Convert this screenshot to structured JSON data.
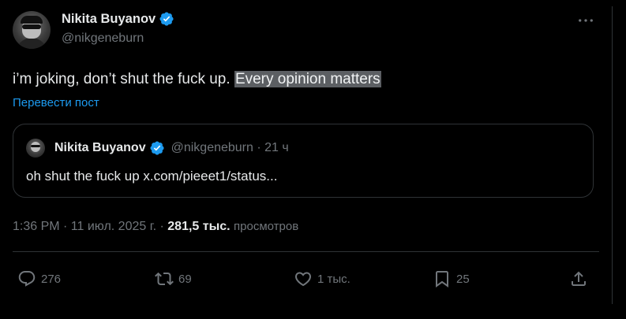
{
  "author": {
    "display_name": "Nikita Buyanov",
    "handle": "@nikgeneburn"
  },
  "tweet": {
    "text_plain": "i’m joking, don’t shut the fuck up.",
    "text_highlighted": "Every opinion matters",
    "translate_link": "Перевести пост"
  },
  "quoted": {
    "display_name": "Nikita Buyanov",
    "meta": "@nikgeneburn · 21 ч",
    "text": "oh shut the fuck up x.com/pieeet1/status..."
  },
  "meta": {
    "timestamp": "1:36 PM · 11 июл. 2025 г. · ",
    "views_count": "281,5 тыс.",
    "views_label": "просмотров"
  },
  "actions": {
    "replies": "276",
    "retweets": "69",
    "likes": "1 тыс.",
    "bookmarks": "25"
  },
  "icons": {
    "verified": "verified-badge-icon",
    "more": "more-icon",
    "reply": "reply-icon",
    "retweet": "retweet-icon",
    "like": "heart-icon",
    "bookmark": "bookmark-icon",
    "share": "share-icon"
  },
  "colors": {
    "background": "#000000",
    "text": "#e7e9ea",
    "muted": "#71767b",
    "accent": "#1d9bf0",
    "border": "#2f3336",
    "highlight": "#5c5f63"
  }
}
